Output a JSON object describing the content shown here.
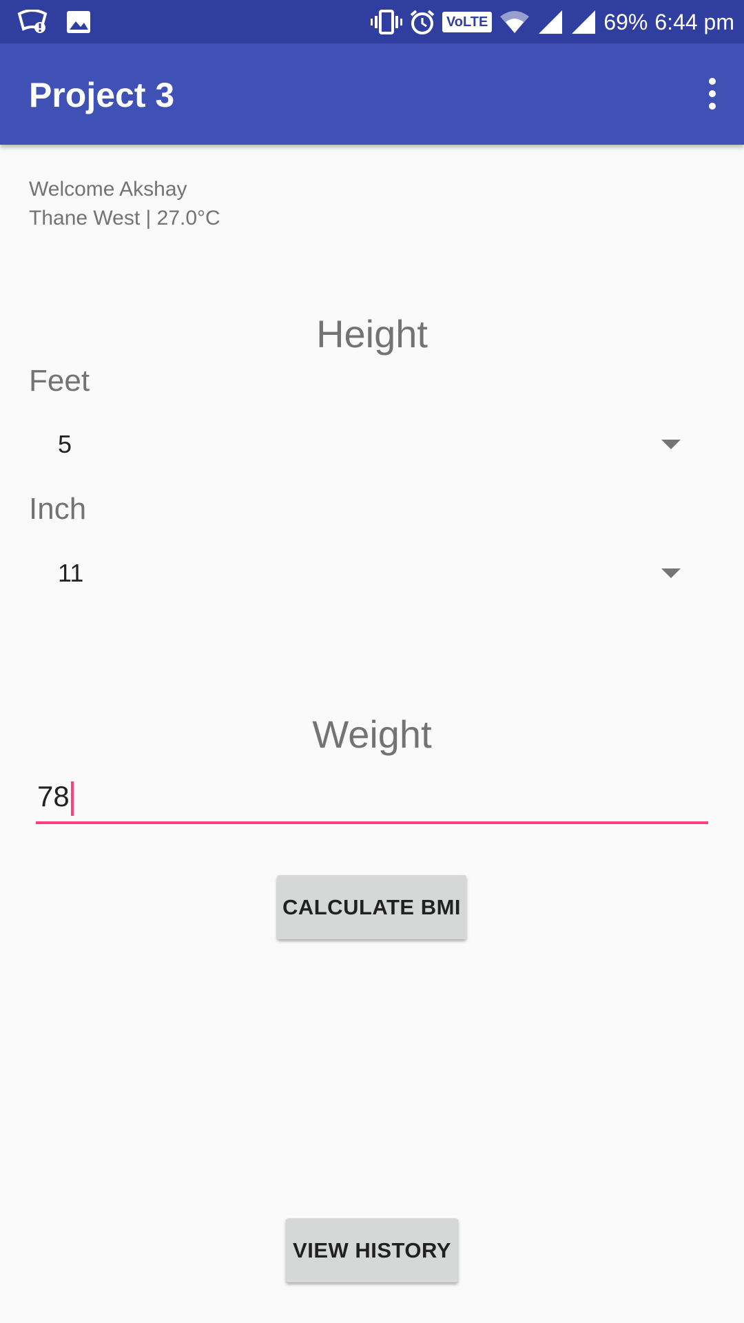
{
  "status_bar": {
    "battery": "69%",
    "time": "6:44 pm",
    "volte": "VoLTE",
    "icons_left": [
      "notification-icon",
      "image-icon"
    ],
    "icons_right": [
      "vibrate-icon",
      "alarm-icon",
      "volte-icon",
      "wifi-icon",
      "signal-icon",
      "signal-icon-2"
    ]
  },
  "app_bar": {
    "title": "Project 3",
    "menu_icon": "overflow-menu-icon"
  },
  "welcome": {
    "greeting": "Welcome Akshay",
    "location": "Thane West | 27.0°C"
  },
  "height": {
    "title": "Height",
    "feet_label": "Feet",
    "feet_value": "5",
    "inch_label": "Inch",
    "inch_value": "11"
  },
  "weight": {
    "title": "Weight",
    "value": "78"
  },
  "buttons": {
    "calculate": "CALCULATE BMI",
    "history": "VIEW HISTORY"
  },
  "colors": {
    "status_bar": "#303f9f",
    "app_bar": "#3f51b5",
    "accent": "#ff4081",
    "background": "#fafafa"
  }
}
